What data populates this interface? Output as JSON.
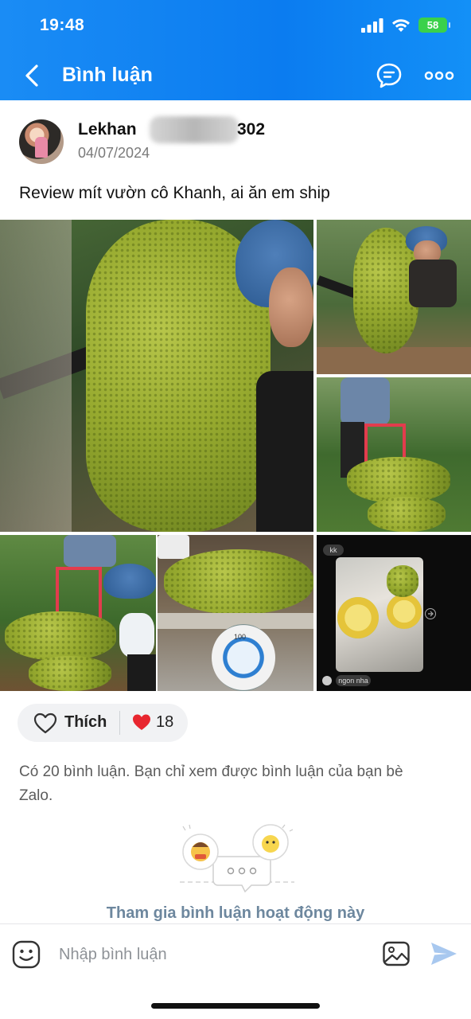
{
  "status_bar": {
    "time": "19:48",
    "battery": "58"
  },
  "nav": {
    "title": "Bình luận"
  },
  "post": {
    "author_prefix": "Lekhan",
    "author_suffix": "302",
    "date": "04/07/2024",
    "text": "Review mít vườn cô Khanh, ai ăn em ship",
    "scale_reading": "100",
    "chat_photo_top": "kk",
    "chat_photo_bottom": "ngon nha"
  },
  "reactions": {
    "like_label": "Thích",
    "count": "18"
  },
  "comments": {
    "note": "Có 20 bình luận. Bạn chỉ xem được bình luận của bạn bè Zalo.",
    "join_prompt": "Tham gia bình luận hoạt động này"
  },
  "composer": {
    "placeholder": "Nhập bình luận"
  },
  "colors": {
    "header": "#0b7cf0",
    "like_heart": "#e8262f",
    "send": "#a8c8ef",
    "join_text": "#6d879e"
  },
  "icons": [
    "back-chevron-icon",
    "chat-icon",
    "more-icon",
    "heart-outline-icon",
    "heart-filled-icon",
    "sticker-icon",
    "image-icon",
    "send-icon"
  ]
}
